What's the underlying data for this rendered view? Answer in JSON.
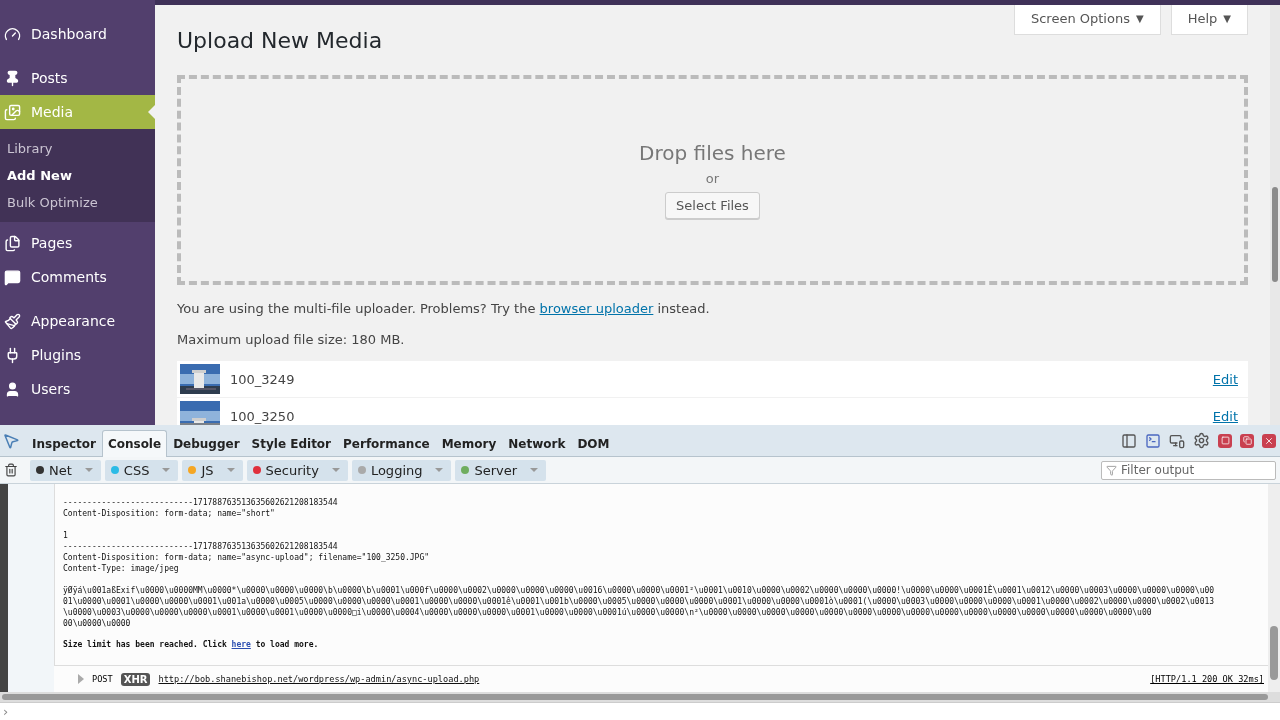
{
  "sidebar": {
    "items": [
      {
        "label": "Dashboard",
        "selected": false
      },
      {
        "label": "Posts",
        "selected": false
      },
      {
        "label": "Media",
        "selected": true,
        "children": [
          {
            "label": "Library",
            "selected": false
          },
          {
            "label": "Add New",
            "selected": true
          },
          {
            "label": "Bulk Optimize",
            "selected": false
          }
        ]
      },
      {
        "label": "Pages",
        "selected": false
      },
      {
        "label": "Comments",
        "selected": false
      },
      {
        "label": "Appearance",
        "selected": false
      },
      {
        "label": "Plugins",
        "selected": false
      },
      {
        "label": "Users",
        "selected": false
      }
    ]
  },
  "header_buttons": [
    {
      "label": "Screen Options",
      "caret": "▼"
    },
    {
      "label": "Help",
      "caret": "▼"
    }
  ],
  "page_title": "Upload New Media",
  "dropzone": {
    "heading": "Drop files here",
    "or": "or",
    "button": "Select Files"
  },
  "uploader_note": {
    "before": "You are using the multi-file uploader. Problems? Try the ",
    "link": "browser uploader",
    "after": " instead."
  },
  "max_size": "Maximum upload file size: 180 MB.",
  "media_items": [
    {
      "name": "100_3249",
      "action": "Edit",
      "kind": "picture"
    },
    {
      "name": "100_3250",
      "action": "Edit",
      "kind": "picture"
    }
  ],
  "devtools": {
    "tabs": [
      {
        "label": "Inspector",
        "selected": false
      },
      {
        "label": "Console",
        "selected": true
      },
      {
        "label": "Debugger",
        "selected": false
      },
      {
        "label": "Style Editor",
        "selected": false
      },
      {
        "label": "Performance",
        "selected": false
      },
      {
        "label": "Memory",
        "selected": false
      },
      {
        "label": "Network",
        "selected": false
      },
      {
        "label": "DOM",
        "selected": false
      }
    ],
    "filters": [
      {
        "label": "Net",
        "color": "#333333"
      },
      {
        "label": "CSS",
        "color": "#2cbbe6"
      },
      {
        "label": "JS",
        "color": "#f5a623"
      },
      {
        "label": "Security",
        "color": "#e0303c"
      },
      {
        "label": "Logging",
        "color": "#aaaaaa"
      },
      {
        "label": "Server",
        "color": "#6fad5f"
      }
    ],
    "filter_placeholder": "Filter output",
    "log_blocks": [
      [
        "---------------------------171788763513635602621208183544",
        "Content-Disposition: form-data; name=\"short\""
      ],
      [
        "1",
        "---------------------------171788763513635602621208183544",
        "Content-Disposition: form-data; name=\"async-upload\"; filename=\"100_3250.JPG\"",
        "Content-Type: image/jpeg"
      ],
      [
        "ÿØÿá\\u001aßExif\\u0000\\u0000MM\\u0000*\\u0000\\u0000\\u0000\\b\\u0000\\b\\u0001\\u000f\\u0000\\u0002\\u0000\\u0000\\u0000\\u0016\\u0000\\u0000\\u0001²\\u0001\\u0010\\u0000\\u0002\\u0000\\u0000\\u0000!\\u0000\\u0000\\u0001È\\u0001\\u0012\\u0000\\u0003\\u0000\\u0000\\u0000\\u00",
        "01\\u0000\\u0001\\u0000\\u0000\\u0001\\u001a\\u0000\\u0005\\u0000\\u0000\\u0000\\u0001\\u0000\\u0000\\u0001ê\\u0001\\u001b\\u0000\\u0005\\u0000\\u0000\\u0000\\u0001\\u0000\\u0000\\u0001ò\\u0001(\\u0000\\u0003\\u0000\\u0000\\u0000\\u0001\\u0000\\u0002\\u0000\\u0000\\u0002\\u0013",
        "\\u0000\\u0003\\u0000\\u0000\\u0000\\u0001\\u0000\\u0001\\u0000\\u0000□i\\u0000\\u0004\\u0000\\u0000\\u0000\\u0001\\u0000\\u0000\\u0001ú\\u0000\\u0000\\n²\\u0000\\u0000\\u0000\\u0000\\u0000\\u0000\\u0000\\u0000\\u0000\\u0000\\u0000\\u0000\\u0000\\u0000\\u0000\\u00",
        "00\\u0000\\u0000"
      ]
    ],
    "size_limit": {
      "before": "Size limit has been reached. Click ",
      "link": "here",
      "after": " to load more."
    },
    "request": {
      "method": "POST",
      "badge": "XHR",
      "url": "http://bob.shanebishop.net/wordpress/wp-admin/async-upload.php",
      "status": "[HTTP/1.1 200 OK 32ms]"
    },
    "prompt": "›"
  }
}
